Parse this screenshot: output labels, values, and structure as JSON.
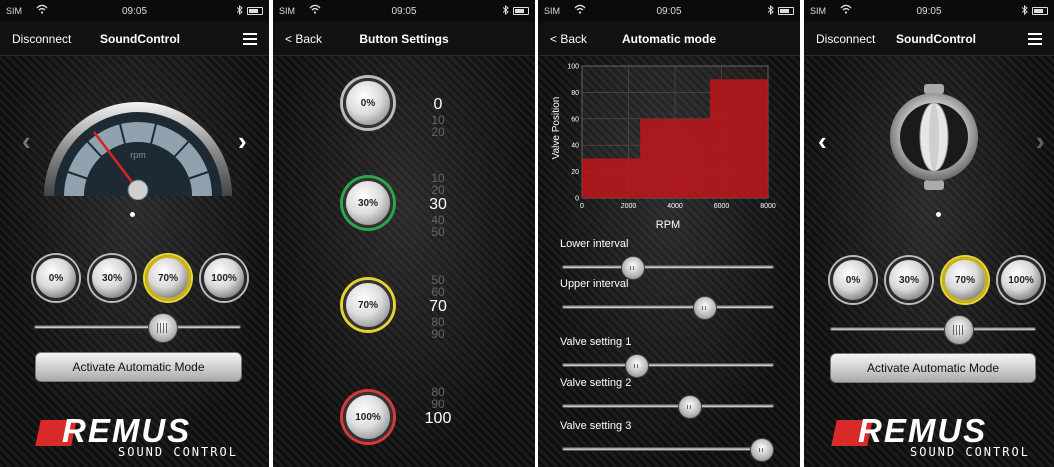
{
  "status": {
    "carrier": "SIM",
    "time": "09:05"
  },
  "screen1": {
    "left_action": "Disconnect",
    "title": "SoundControl",
    "gauge_label": "rpm",
    "presets": [
      "0%",
      "30%",
      "70%",
      "100%"
    ],
    "active_preset": "70%",
    "slider_value": 0.62,
    "button": "Activate Automatic Mode",
    "logo": "REMUS",
    "logo_sub": "SOUND CONTROL"
  },
  "screen2": {
    "back": "< Back",
    "title": "Button Settings",
    "buttons": [
      {
        "label": "0%",
        "ring": "#bdbdbd",
        "picker": [
          "",
          "",
          "0",
          "10",
          "20"
        ],
        "selected": "0"
      },
      {
        "label": "30%",
        "ring": "#2aa84a",
        "picker": [
          "10",
          "20",
          "30",
          "40",
          "50"
        ],
        "selected": "30"
      },
      {
        "label": "70%",
        "ring": "#e4d32c",
        "picker": [
          "50",
          "60",
          "70",
          "80",
          "90"
        ],
        "selected": "70"
      },
      {
        "label": "100%",
        "ring": "#d83a3a",
        "picker": [
          "80",
          "90",
          "100",
          "",
          ""
        ],
        "selected": "100"
      }
    ]
  },
  "screen3": {
    "back": "< Back",
    "title": "Automatic mode",
    "sliders": [
      {
        "label": "Lower interval",
        "value": 0.33
      },
      {
        "label": "Upper interval",
        "value": 0.67
      },
      {
        "label": "Valve setting 1",
        "value": 0.35
      },
      {
        "label": "Valve setting 2",
        "value": 0.6
      },
      {
        "label": "Valve setting 3",
        "value": 0.94
      }
    ]
  },
  "chart_data": {
    "type": "bar",
    "xlabel": "RPM",
    "ylabel": "Valve Position",
    "x_ticks": [
      "0",
      "2000",
      "4000",
      "6000",
      "8000"
    ],
    "y_ticks": [
      "0",
      "20",
      "40",
      "60",
      "80",
      "100"
    ],
    "xlim": [
      0,
      8000
    ],
    "ylim": [
      0,
      100
    ],
    "bars": [
      {
        "x_start": 0,
        "x_end": 2500,
        "value": 30
      },
      {
        "x_start": 2500,
        "x_end": 5500,
        "value": 60
      },
      {
        "x_start": 5500,
        "x_end": 8000,
        "value": 90
      }
    ],
    "color": "#c0151a",
    "grid": true
  },
  "screen4": {
    "left_action": "Disconnect",
    "title": "SoundControl",
    "presets": [
      "0%",
      "30%",
      "70%",
      "100%"
    ],
    "active_preset": "70%",
    "slider_value": 0.62,
    "button": "Activate Automatic Mode",
    "logo": "REMUS",
    "logo_sub": "SOUND CONTROL"
  }
}
